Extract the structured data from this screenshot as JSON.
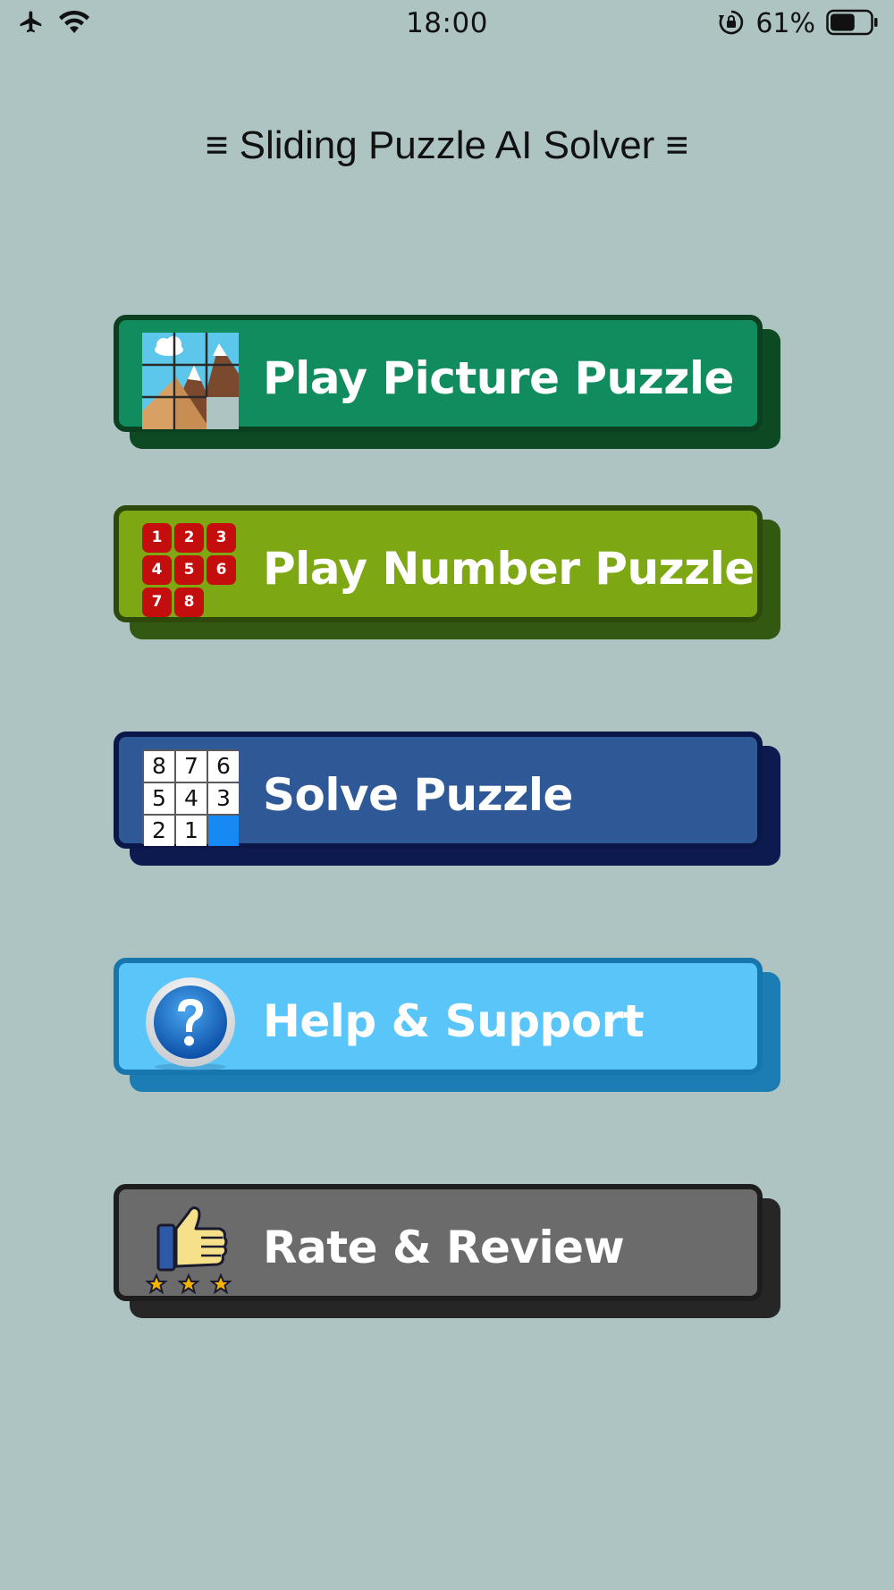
{
  "status_bar": {
    "time": "18:00",
    "battery_percent": "61%",
    "battery_level": 0.61,
    "icons": [
      "airplane-icon",
      "wifi-icon",
      "orientation-lock-icon",
      "battery-icon"
    ]
  },
  "header": {
    "title": "≡ Sliding Puzzle AI Solver ≡"
  },
  "menu": {
    "picture": {
      "label": "Play Picture Puzzle",
      "icon": "mountain-picture-icon",
      "color": "#118c5f"
    },
    "number": {
      "label": "Play Number Puzzle",
      "icon": "number-tiles-icon",
      "color": "#7ea714",
      "tiles": [
        "1",
        "2",
        "3",
        "4",
        "5",
        "6",
        "7",
        "8",
        ""
      ]
    },
    "solve": {
      "label": "Solve Puzzle",
      "icon": "solve-grid-icon",
      "color": "#2f5996",
      "tiles": [
        "8",
        "7",
        "6",
        "5",
        "4",
        "3",
        "2",
        "1",
        ""
      ]
    },
    "help": {
      "label": "Help & Support",
      "icon": "question-mark-icon",
      "color": "#5ac5f9"
    },
    "rate": {
      "label": "Rate & Review",
      "icon": "thumbs-up-stars-icon",
      "color": "#6b6b6b",
      "stars": 3
    }
  }
}
